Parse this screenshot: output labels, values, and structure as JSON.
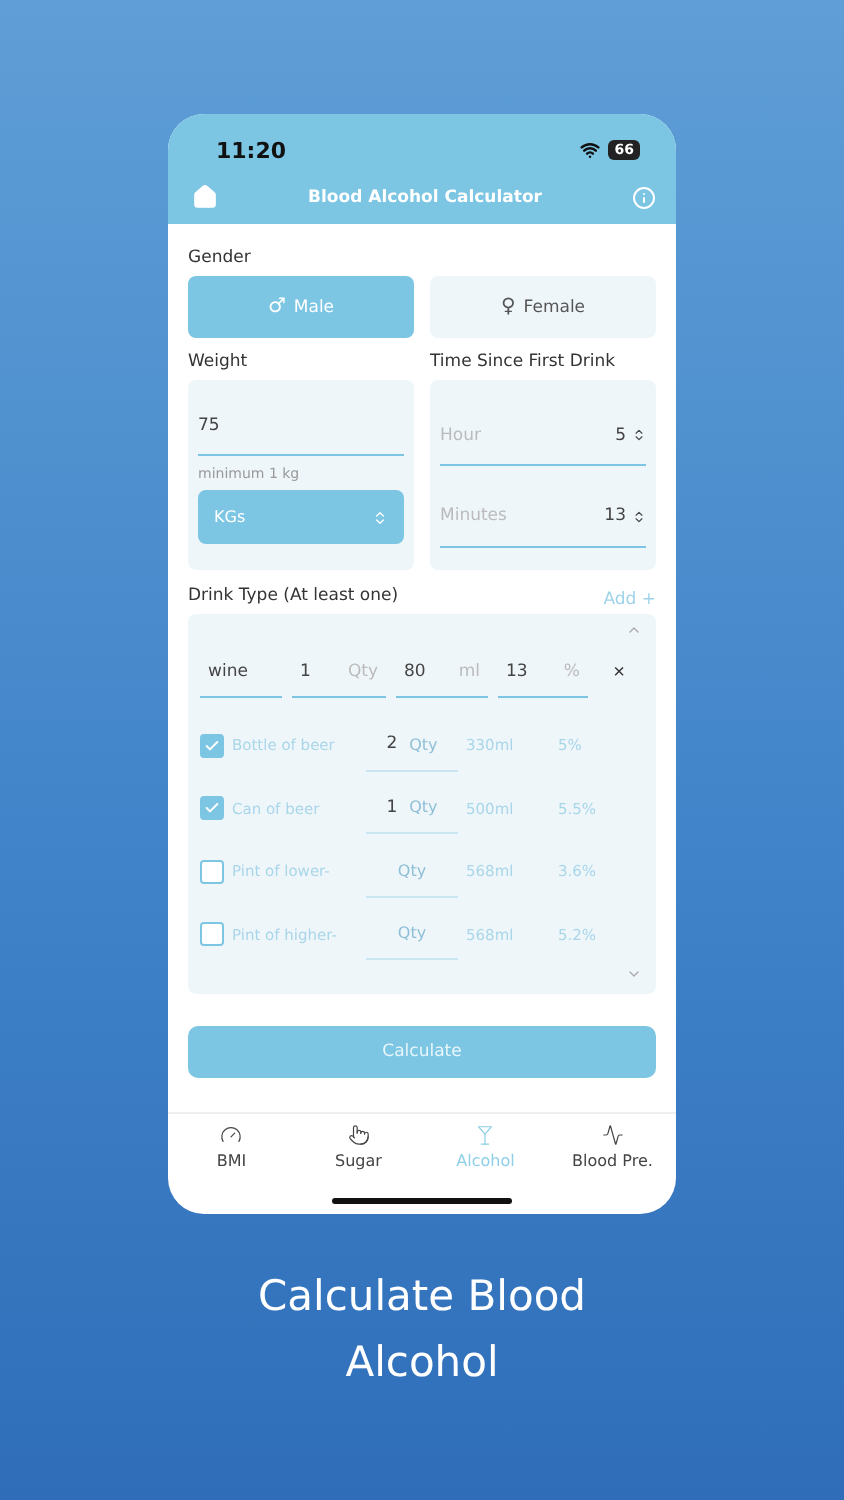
{
  "status_bar": {
    "time": "11:20",
    "battery": "66"
  },
  "header": {
    "title": "Blood Alcohol Calculator"
  },
  "gender": {
    "label": "Gender",
    "options": [
      {
        "label": "Male",
        "symbol": "♂",
        "selected": true
      },
      {
        "label": "Female",
        "symbol": "♀",
        "selected": false
      }
    ]
  },
  "weight": {
    "label": "Weight",
    "value": "75",
    "hint": "minimum 1 kg",
    "unit": "KGs"
  },
  "time": {
    "label": "Time Since First Drink",
    "fields": [
      {
        "placeholder": "Hour",
        "value": "5"
      },
      {
        "placeholder": "Minutes",
        "value": "13"
      }
    ]
  },
  "drinks": {
    "label": "Drink Type (At least one)",
    "add": "Add +",
    "custom": {
      "name": "wine",
      "qty": "1",
      "qty_unit": "Qty",
      "volume": "80",
      "volume_unit": "ml",
      "percent": "13",
      "percent_unit": "%",
      "remove": "×"
    },
    "items": [
      {
        "name": "Bottle of beer",
        "checked": true,
        "qty": "2",
        "qty_unit": "Qty",
        "volume": "330ml",
        "abv": "5%"
      },
      {
        "name": "Can of beer",
        "checked": true,
        "qty": "1",
        "qty_unit": "Qty",
        "volume": "500ml",
        "abv": "5.5%"
      },
      {
        "name": "Pint of lower-",
        "checked": false,
        "qty_unit": "Qty",
        "volume": "568ml",
        "abv": "3.6%"
      },
      {
        "name": "Pint of higher-",
        "checked": false,
        "qty_unit": "Qty",
        "volume": "568ml",
        "abv": "5.2%"
      }
    ]
  },
  "calculate": "Calculate",
  "tabs": [
    {
      "label": "BMI",
      "selected": false
    },
    {
      "label": "Sugar",
      "selected": false
    },
    {
      "label": "Alcohol",
      "selected": true
    },
    {
      "label": "Blood Pre.",
      "selected": false
    }
  ],
  "caption": "Calculate Blood Alcohol"
}
